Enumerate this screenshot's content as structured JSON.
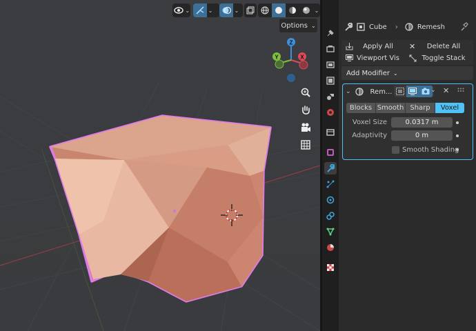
{
  "viewport": {
    "options_label": "Options",
    "header_icons": [
      "eye-icon",
      "gizmo-icon",
      "overlay-icon",
      "xray-icon",
      "wireframe-shading-icon",
      "solid-shading-icon",
      "material-shading-icon",
      "rendered-shading-icon"
    ],
    "gizmo_axes": {
      "x": "X",
      "y": "Y",
      "z": "Z"
    },
    "nav_tools": [
      "zoom-icon",
      "hand-pan-icon",
      "camera-icon",
      "grid-ortho-icon"
    ]
  },
  "properties": {
    "search_placeholder": "",
    "breadcrumb": {
      "object": "Cube",
      "modifier": "Remesh"
    },
    "toolbar": {
      "apply_all": "Apply All",
      "delete_all": "Delete All",
      "viewport_vis": "Viewport Vis",
      "toggle_stack": "Toggle Stack"
    },
    "add_modifier": "Add Modifier",
    "modifier": {
      "name": "Rem...",
      "modes": [
        "Blocks",
        "Smooth",
        "Sharp",
        "Voxel"
      ],
      "active_mode": "Voxel",
      "voxel_size_label": "Voxel Size",
      "voxel_size_value": "0.0317 m",
      "adaptivity_label": "Adaptivity",
      "adaptivity_value": "0 m",
      "smooth_shading_label": "Smooth Shading",
      "smooth_shading_checked": false
    },
    "tabs": [
      "tool",
      "render",
      "output",
      "view-layer",
      "scene",
      "world",
      "collection",
      "object",
      "modifiers",
      "particles",
      "physics",
      "constraints",
      "data",
      "material",
      "texture"
    ],
    "active_tab": "modifiers"
  },
  "colors": {
    "accent": "#4fc3f7",
    "active_tab_blue": "#3da3d8",
    "mesh": "#d8917a",
    "outline": "#e07ae8",
    "axis_x": "#e04a57",
    "axis_y": "#7fbf3f",
    "axis_z": "#3f8fd9"
  }
}
